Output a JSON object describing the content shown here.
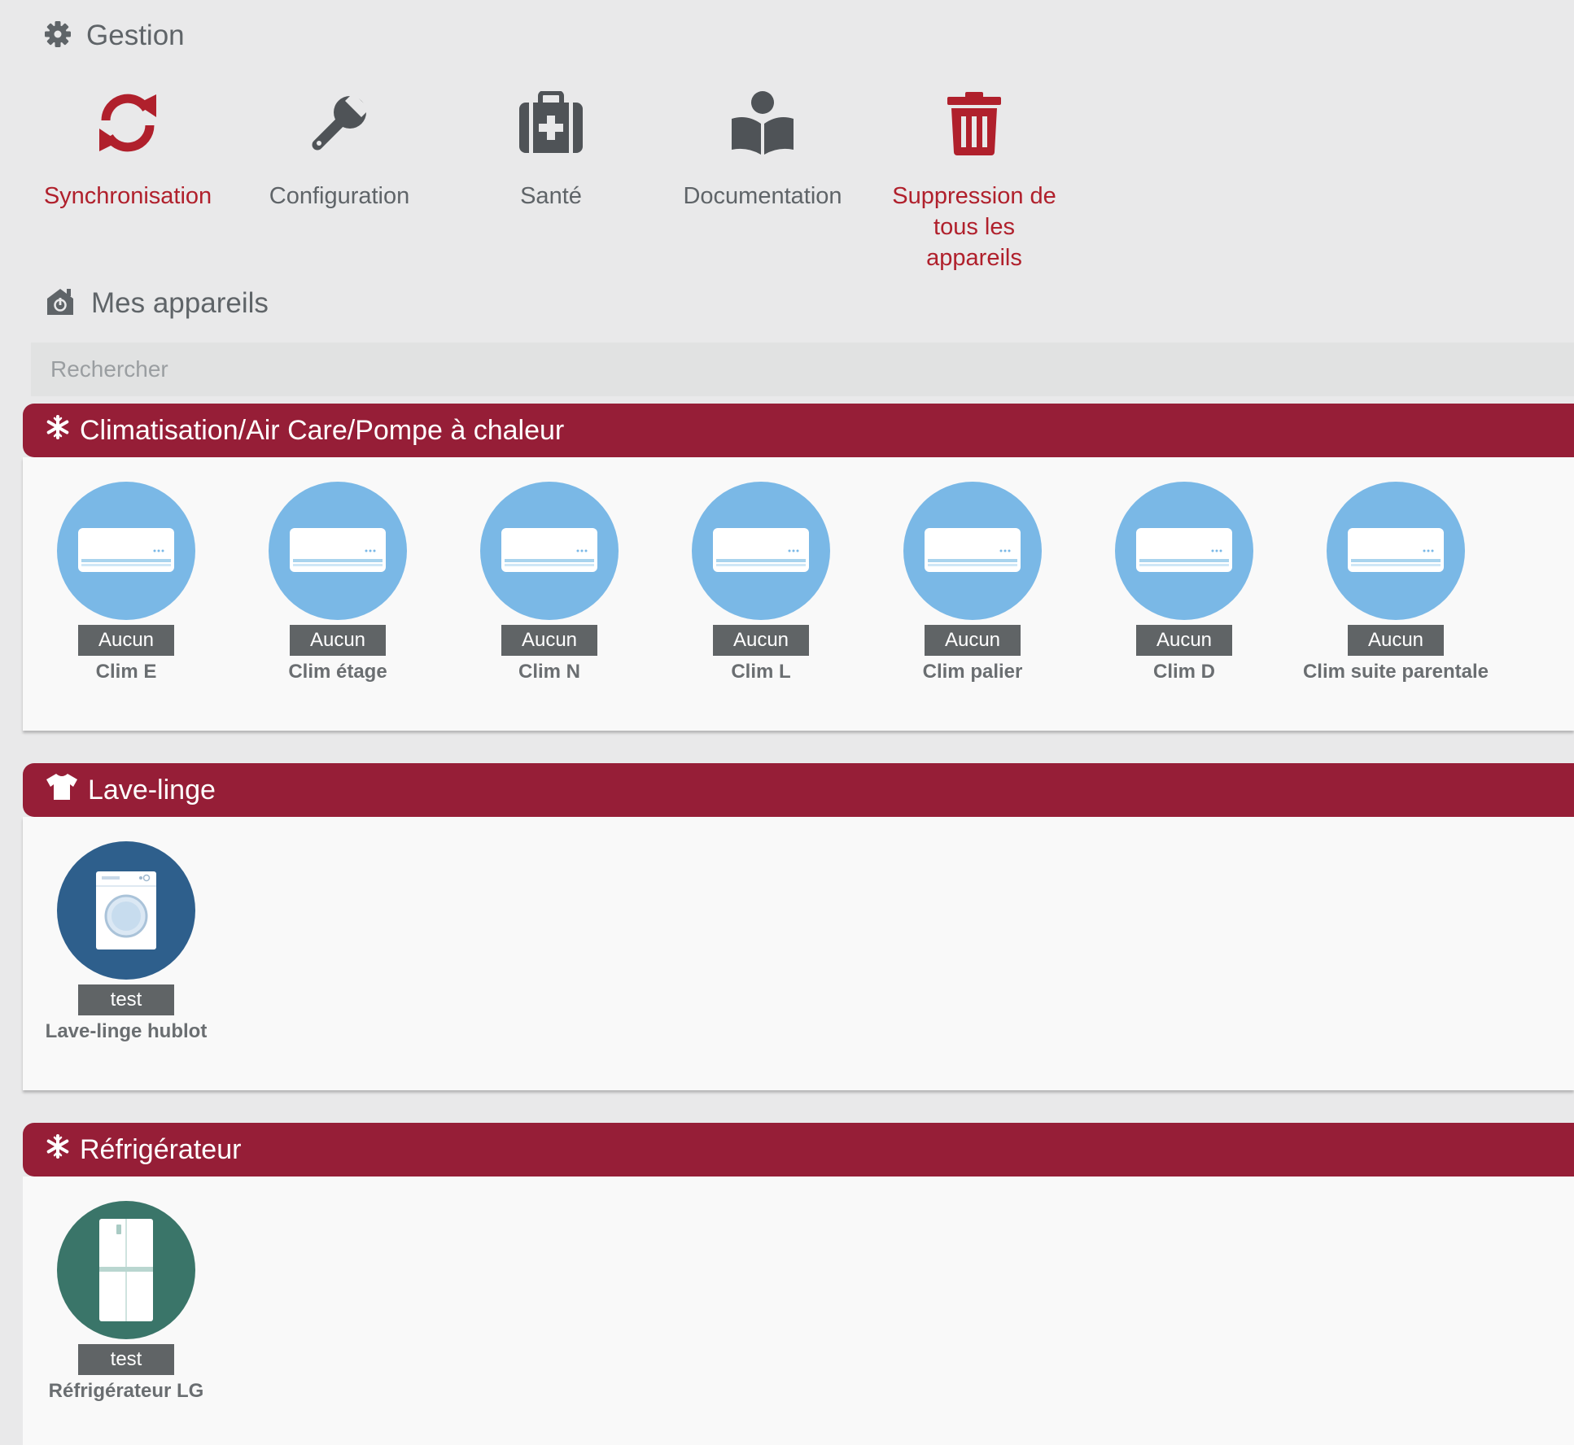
{
  "gestion": {
    "title": "Gestion",
    "actions": [
      {
        "label": "Synchronisation",
        "icon": "sync-icon",
        "color": "#b0202c"
      },
      {
        "label": "Configuration",
        "icon": "wrench-icon"
      },
      {
        "label": "Santé",
        "icon": "medkit-icon"
      },
      {
        "label": "Documentation",
        "icon": "book-reader-icon"
      },
      {
        "label": "Suppression de tous les appareils",
        "icon": "trash-icon",
        "color": "#b0202c"
      }
    ]
  },
  "devices": {
    "title": "Mes appareils",
    "search_placeholder": "Rechercher"
  },
  "categories": [
    {
      "title": "Climatisation/Air Care/Pompe à chaleur",
      "icon": "snowflake-icon",
      "items": [
        {
          "badge": "Aucun",
          "name": "Clim E",
          "type": "air-conditioner"
        },
        {
          "badge": "Aucun",
          "name": "Clim étage",
          "type": "air-conditioner"
        },
        {
          "badge": "Aucun",
          "name": "Clim N",
          "type": "air-conditioner"
        },
        {
          "badge": "Aucun",
          "name": "Clim L",
          "type": "air-conditioner"
        },
        {
          "badge": "Aucun",
          "name": "Clim palier",
          "type": "air-conditioner"
        },
        {
          "badge": "Aucun",
          "name": "Clim D",
          "type": "air-conditioner"
        },
        {
          "badge": "Aucun",
          "name": "Clim suite parentale",
          "type": "air-conditioner"
        }
      ]
    },
    {
      "title": "Lave-linge",
      "icon": "tshirt-icon",
      "items": [
        {
          "badge": "test",
          "name": "Lave-linge hublot",
          "type": "washing-machine"
        }
      ]
    },
    {
      "title": "Réfrigérateur",
      "icon": "snowflake-icon",
      "items": [
        {
          "badge": "test",
          "name": "Réfrigérateur LG",
          "type": "refrigerator"
        }
      ]
    }
  ],
  "colors": {
    "accent": "#961e37",
    "danger": "#b0202c",
    "ac_circle": "#7ab8e6",
    "wash_circle": "#2e5f8c",
    "fridge_circle": "#3a7569",
    "badge_bg": "#606466"
  }
}
